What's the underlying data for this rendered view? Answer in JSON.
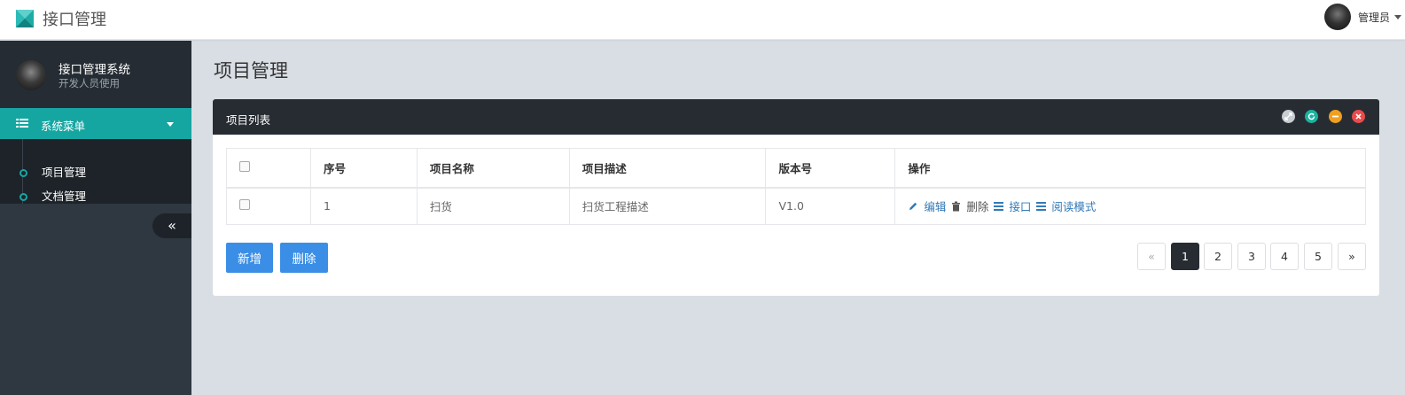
{
  "app": {
    "title": "接口管理",
    "user": "管理员"
  },
  "sidebar": {
    "profile_name": "接口管理系统",
    "profile_role": "开发人员使用",
    "menu_title": "系统菜单",
    "items": [
      {
        "label": "项目管理"
      },
      {
        "label": "文档管理"
      }
    ],
    "collapse_icon": "«"
  },
  "main": {
    "page_title": "项目管理",
    "panel_title": "项目列表",
    "tools": [
      "expand-icon",
      "refresh-icon",
      "minimize-icon",
      "close-icon"
    ],
    "table": {
      "headers": [
        "序号",
        "项目名称",
        "项目描述",
        "版本号",
        "操作"
      ],
      "rows": [
        {
          "index": "1",
          "name": "扫货",
          "desc": "扫货工程描述",
          "version": "V1.0"
        }
      ],
      "actions": {
        "edit": "编辑",
        "delete": "删除",
        "api": "接口",
        "read": "阅读模式"
      }
    },
    "buttons": {
      "add": "新增",
      "delete": "删除"
    },
    "pagination": {
      "prev": "«",
      "pages": [
        "1",
        "2",
        "3",
        "4",
        "5"
      ],
      "next": "»",
      "current": "1"
    }
  },
  "colors": {
    "accent": "#16a6a2",
    "primary": "#3a8ee6",
    "dark": "#272c33"
  }
}
